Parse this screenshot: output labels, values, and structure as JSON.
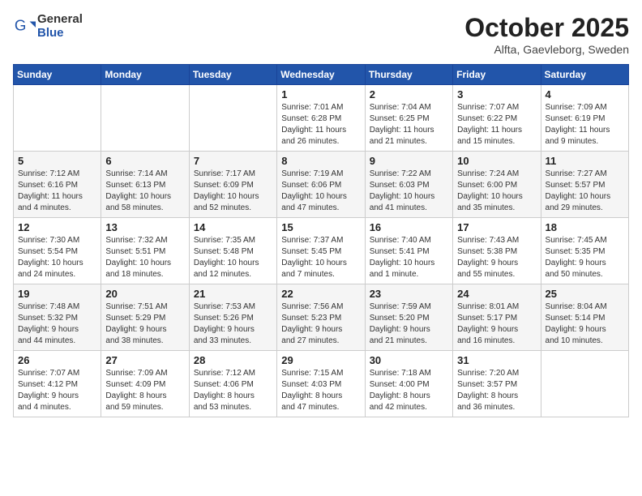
{
  "header": {
    "logo_general": "General",
    "logo_blue": "Blue",
    "month": "October 2025",
    "location": "Alfta, Gaevleborg, Sweden"
  },
  "days_of_week": [
    "Sunday",
    "Monday",
    "Tuesday",
    "Wednesday",
    "Thursday",
    "Friday",
    "Saturday"
  ],
  "weeks": [
    [
      {
        "day": "",
        "info": ""
      },
      {
        "day": "",
        "info": ""
      },
      {
        "day": "",
        "info": ""
      },
      {
        "day": "1",
        "info": "Sunrise: 7:01 AM\nSunset: 6:28 PM\nDaylight: 11 hours\nand 26 minutes."
      },
      {
        "day": "2",
        "info": "Sunrise: 7:04 AM\nSunset: 6:25 PM\nDaylight: 11 hours\nand 21 minutes."
      },
      {
        "day": "3",
        "info": "Sunrise: 7:07 AM\nSunset: 6:22 PM\nDaylight: 11 hours\nand 15 minutes."
      },
      {
        "day": "4",
        "info": "Sunrise: 7:09 AM\nSunset: 6:19 PM\nDaylight: 11 hours\nand 9 minutes."
      }
    ],
    [
      {
        "day": "5",
        "info": "Sunrise: 7:12 AM\nSunset: 6:16 PM\nDaylight: 11 hours\nand 4 minutes."
      },
      {
        "day": "6",
        "info": "Sunrise: 7:14 AM\nSunset: 6:13 PM\nDaylight: 10 hours\nand 58 minutes."
      },
      {
        "day": "7",
        "info": "Sunrise: 7:17 AM\nSunset: 6:09 PM\nDaylight: 10 hours\nand 52 minutes."
      },
      {
        "day": "8",
        "info": "Sunrise: 7:19 AM\nSunset: 6:06 PM\nDaylight: 10 hours\nand 47 minutes."
      },
      {
        "day": "9",
        "info": "Sunrise: 7:22 AM\nSunset: 6:03 PM\nDaylight: 10 hours\nand 41 minutes."
      },
      {
        "day": "10",
        "info": "Sunrise: 7:24 AM\nSunset: 6:00 PM\nDaylight: 10 hours\nand 35 minutes."
      },
      {
        "day": "11",
        "info": "Sunrise: 7:27 AM\nSunset: 5:57 PM\nDaylight: 10 hours\nand 29 minutes."
      }
    ],
    [
      {
        "day": "12",
        "info": "Sunrise: 7:30 AM\nSunset: 5:54 PM\nDaylight: 10 hours\nand 24 minutes."
      },
      {
        "day": "13",
        "info": "Sunrise: 7:32 AM\nSunset: 5:51 PM\nDaylight: 10 hours\nand 18 minutes."
      },
      {
        "day": "14",
        "info": "Sunrise: 7:35 AM\nSunset: 5:48 PM\nDaylight: 10 hours\nand 12 minutes."
      },
      {
        "day": "15",
        "info": "Sunrise: 7:37 AM\nSunset: 5:45 PM\nDaylight: 10 hours\nand 7 minutes."
      },
      {
        "day": "16",
        "info": "Sunrise: 7:40 AM\nSunset: 5:41 PM\nDaylight: 10 hours\nand 1 minute."
      },
      {
        "day": "17",
        "info": "Sunrise: 7:43 AM\nSunset: 5:38 PM\nDaylight: 9 hours\nand 55 minutes."
      },
      {
        "day": "18",
        "info": "Sunrise: 7:45 AM\nSunset: 5:35 PM\nDaylight: 9 hours\nand 50 minutes."
      }
    ],
    [
      {
        "day": "19",
        "info": "Sunrise: 7:48 AM\nSunset: 5:32 PM\nDaylight: 9 hours\nand 44 minutes."
      },
      {
        "day": "20",
        "info": "Sunrise: 7:51 AM\nSunset: 5:29 PM\nDaylight: 9 hours\nand 38 minutes."
      },
      {
        "day": "21",
        "info": "Sunrise: 7:53 AM\nSunset: 5:26 PM\nDaylight: 9 hours\nand 33 minutes."
      },
      {
        "day": "22",
        "info": "Sunrise: 7:56 AM\nSunset: 5:23 PM\nDaylight: 9 hours\nand 27 minutes."
      },
      {
        "day": "23",
        "info": "Sunrise: 7:59 AM\nSunset: 5:20 PM\nDaylight: 9 hours\nand 21 minutes."
      },
      {
        "day": "24",
        "info": "Sunrise: 8:01 AM\nSunset: 5:17 PM\nDaylight: 9 hours\nand 16 minutes."
      },
      {
        "day": "25",
        "info": "Sunrise: 8:04 AM\nSunset: 5:14 PM\nDaylight: 9 hours\nand 10 minutes."
      }
    ],
    [
      {
        "day": "26",
        "info": "Sunrise: 7:07 AM\nSunset: 4:12 PM\nDaylight: 9 hours\nand 4 minutes."
      },
      {
        "day": "27",
        "info": "Sunrise: 7:09 AM\nSunset: 4:09 PM\nDaylight: 8 hours\nand 59 minutes."
      },
      {
        "day": "28",
        "info": "Sunrise: 7:12 AM\nSunset: 4:06 PM\nDaylight: 8 hours\nand 53 minutes."
      },
      {
        "day": "29",
        "info": "Sunrise: 7:15 AM\nSunset: 4:03 PM\nDaylight: 8 hours\nand 47 minutes."
      },
      {
        "day": "30",
        "info": "Sunrise: 7:18 AM\nSunset: 4:00 PM\nDaylight: 8 hours\nand 42 minutes."
      },
      {
        "day": "31",
        "info": "Sunrise: 7:20 AM\nSunset: 3:57 PM\nDaylight: 8 hours\nand 36 minutes."
      },
      {
        "day": "",
        "info": ""
      }
    ]
  ]
}
